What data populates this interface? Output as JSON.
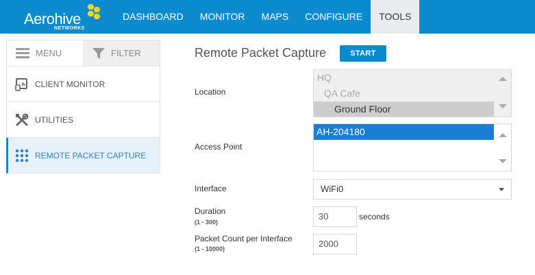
{
  "brand": {
    "name": "Aerohive",
    "sub": "NETWORKS",
    "color": "#0c8ace",
    "accent": "#f7d423"
  },
  "nav": {
    "items": [
      {
        "label": "DASHBOARD"
      },
      {
        "label": "MONITOR"
      },
      {
        "label": "MAPS"
      },
      {
        "label": "CONFIGURE"
      },
      {
        "label": "TOOLS",
        "active": true
      }
    ]
  },
  "sidebar": {
    "menu_label": "MENU",
    "filter_label": "FILTER",
    "items": [
      {
        "label": "CLIENT MONITOR",
        "icon": "client-monitor-icon"
      },
      {
        "label": "UTILITIES",
        "icon": "tools-icon"
      },
      {
        "label": "REMOTE PACKET CAPTURE",
        "icon": "grid-icon",
        "active": true
      }
    ]
  },
  "main": {
    "title": "Remote Packet Capture",
    "start_label": "START",
    "location": {
      "label": "Location",
      "options": [
        "HQ",
        "QA Cafe",
        "Ground Floor"
      ],
      "selected": "Ground Floor"
    },
    "access_point": {
      "label": "Access Point",
      "options": [
        "AH-204180"
      ],
      "selected": "AH-204180"
    },
    "interface": {
      "label": "Interface",
      "value": "WiFi0"
    },
    "duration": {
      "label": "Duration",
      "range": "(1 - 300)",
      "value": "30",
      "unit": "seconds"
    },
    "packet_count": {
      "label": "Packet Count per Interface",
      "range": "(1 - 10000)",
      "value": "2000"
    }
  }
}
